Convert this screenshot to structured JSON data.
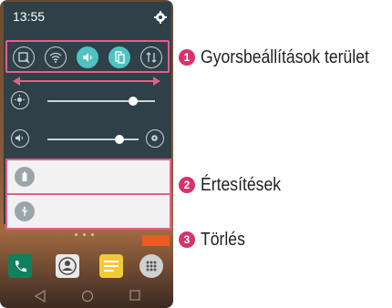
{
  "status_bar": {
    "time": "13:55"
  },
  "callouts": [
    {
      "number": "1",
      "label": "Gyorsbeállítások terület"
    },
    {
      "number": "2",
      "label": "Értesítések"
    },
    {
      "number": "3",
      "label": "Törlés"
    }
  ],
  "colors": {
    "highlight": "#e85d8a",
    "toggle_on": "#4ec3c0",
    "callout_badge": "#d6336c",
    "clear_button": "#ee5a24",
    "shade_bg": "#2f4048"
  },
  "quick_settings": [
    {
      "icon": "screen-capture-icon",
      "active": false
    },
    {
      "icon": "wifi-icon",
      "active": false
    },
    {
      "icon": "sound-icon",
      "active": true
    },
    {
      "icon": "vibrate-icon",
      "active": true
    },
    {
      "icon": "data-transfer-icon",
      "active": false
    }
  ],
  "sliders": {
    "brightness": {
      "icon": "brightness-icon",
      "level": 0.8
    },
    "volume": {
      "icon": "volume-icon",
      "level": 0.6
    }
  },
  "notifications": [
    {
      "icon": "battery-icon"
    },
    {
      "icon": "usb-icon"
    }
  ]
}
